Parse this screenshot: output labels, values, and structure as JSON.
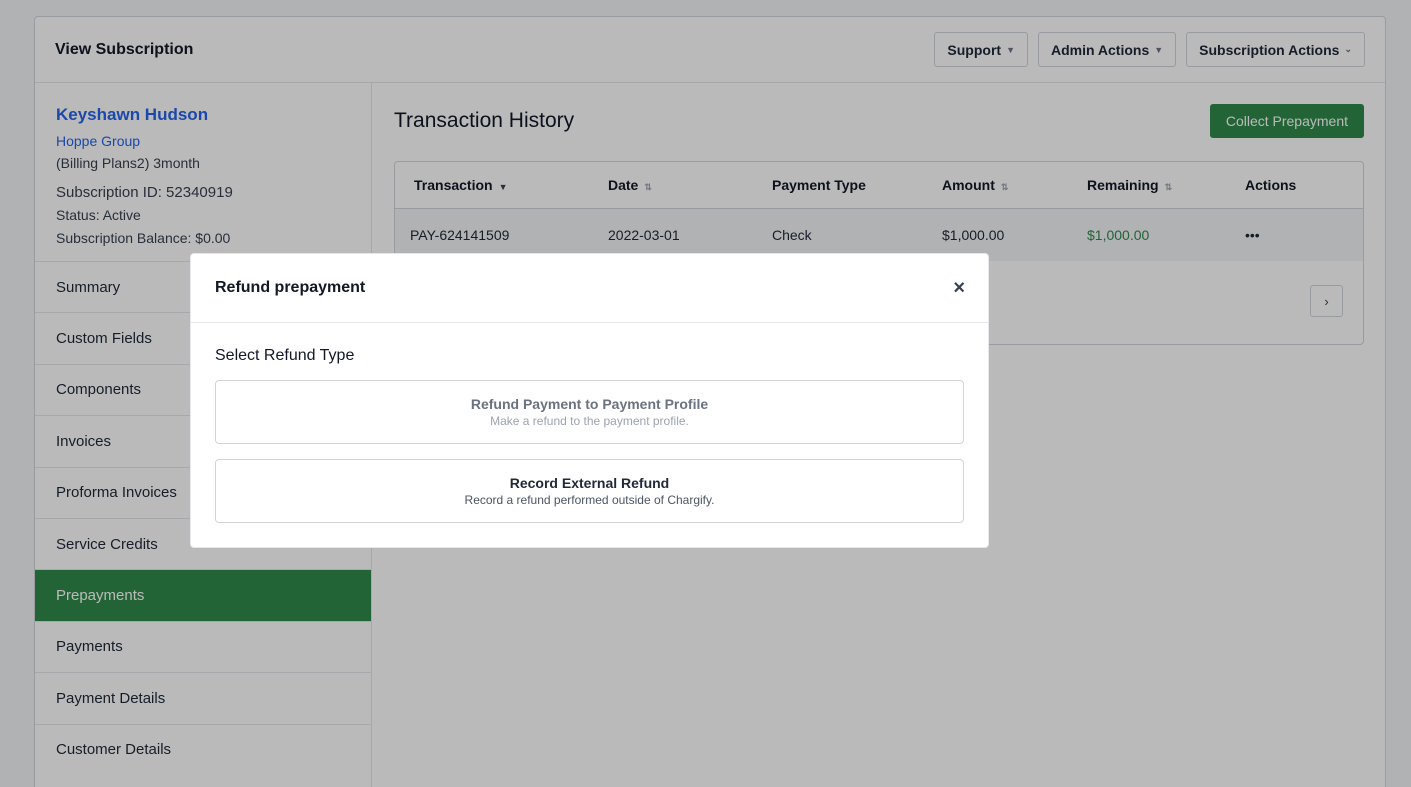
{
  "header": {
    "title": "View Subscription",
    "support_label": "Support",
    "admin_actions_label": "Admin Actions",
    "subscription_actions_label": "Subscription Actions"
  },
  "customer": {
    "name": "Keyshawn Hudson",
    "organization": "Hoppe Group",
    "plan": "(Billing Plans2) 3month",
    "subscription_id": "Subscription ID: 52340919",
    "status": "Status: Active",
    "balance": "Subscription Balance: $0.00"
  },
  "sidebar": {
    "items": [
      {
        "label": "Summary"
      },
      {
        "label": "Custom Fields"
      },
      {
        "label": "Components"
      },
      {
        "label": "Invoices"
      },
      {
        "label": "Proforma Invoices"
      },
      {
        "label": "Service Credits"
      },
      {
        "label": "Prepayments",
        "active": true
      },
      {
        "label": "Payments"
      },
      {
        "label": "Payment Details"
      },
      {
        "label": "Customer Details"
      }
    ]
  },
  "main": {
    "title": "Transaction History",
    "collect_button": "Collect Prepayment",
    "table": {
      "columns": [
        "Transaction",
        "Date",
        "Payment Type",
        "Amount",
        "Remaining",
        "Actions"
      ],
      "rows": [
        {
          "transaction": "PAY-624141509",
          "date": "2022-03-01",
          "payment_type": "Check",
          "amount": "$1,000.00",
          "remaining": "$1,000.00",
          "actions": "•••"
        }
      ]
    },
    "pagination_next": "›"
  },
  "modal": {
    "title": "Refund prepayment",
    "close": "×",
    "section_label": "Select Refund Type",
    "options": [
      {
        "title": "Refund Payment to Payment Profile",
        "description": "Make a refund to the payment profile.",
        "enabled": false
      },
      {
        "title": "Record External Refund",
        "description": "Record a refund performed outside of Chargify.",
        "enabled": true
      }
    ]
  },
  "colors": {
    "brand_green": "#2f8a4a",
    "link_blue": "#2563eb"
  }
}
